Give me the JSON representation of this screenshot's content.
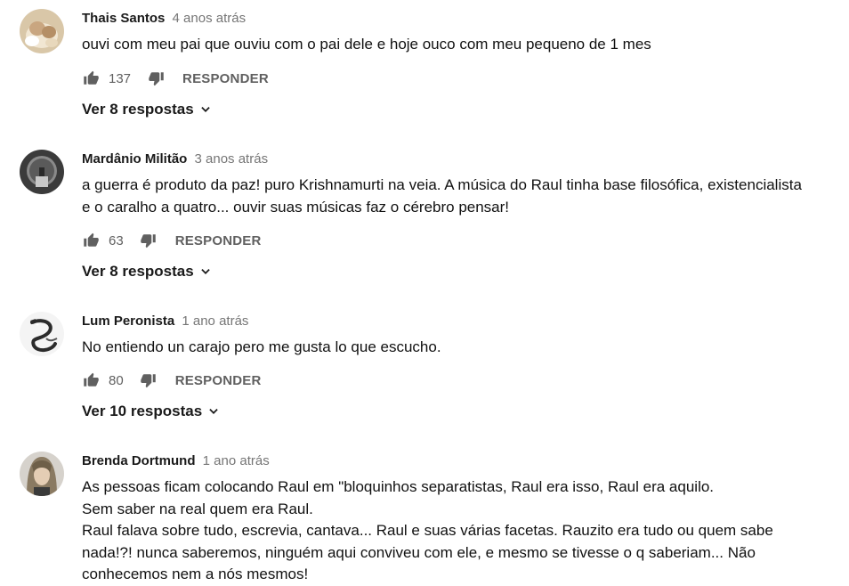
{
  "comments": [
    {
      "author": "Thais Santos",
      "time": "4 anos atrás",
      "text": [
        "ouvi com meu pai que ouviu com o pai dele e hoje ouco com meu pequeno de 1 mes"
      ],
      "likes": "137",
      "reply_label": "RESPONDER",
      "replies_label": "Ver 8 respostas",
      "avatar": "cat-photo"
    },
    {
      "author": "Mardânio Militão",
      "time": "3 anos atrás",
      "text": [
        "a guerra é produto da paz! puro Krishnamurti na veia. A música do Raul tinha base filosófica, existencialista e o caralho a quatro... ouvir suas músicas faz o cérebro pensar!"
      ],
      "likes": "63",
      "reply_label": "RESPONDER",
      "replies_label": "Ver 8 respostas",
      "avatar": "dark-portrait"
    },
    {
      "author": "Lum Peronista",
      "time": "1 ano atrás",
      "text": [
        "No entiendo un carajo pero me gusta lo que escucho."
      ],
      "likes": "80",
      "reply_label": "RESPONDER",
      "replies_label": "Ver 10 respostas",
      "avatar": "dragon-drawing"
    },
    {
      "author": "Brenda Dortmund",
      "time": "1 ano atrás",
      "text": [
        "As pessoas ficam colocando Raul em \"bloquinhos separatistas, Raul era isso, Raul era aquilo.",
        "Sem saber na real quem era Raul.",
        "Raul falava sobre tudo, escrevia, cantava... Raul e suas várias facetas. Rauzito era tudo ou quem sabe nada!?! nunca saberemos, ninguém aqui conviveu com ele, e mesmo se tivesse o q saberiam... Não conhecemos nem a nós mesmos!"
      ],
      "avatar": "person-photo"
    }
  ],
  "colors": {
    "text": "#111111",
    "secondary": "#606060",
    "time": "#767676"
  },
  "icons": [
    "thumbs-up-icon",
    "thumbs-down-icon",
    "chevron-down-icon"
  ]
}
